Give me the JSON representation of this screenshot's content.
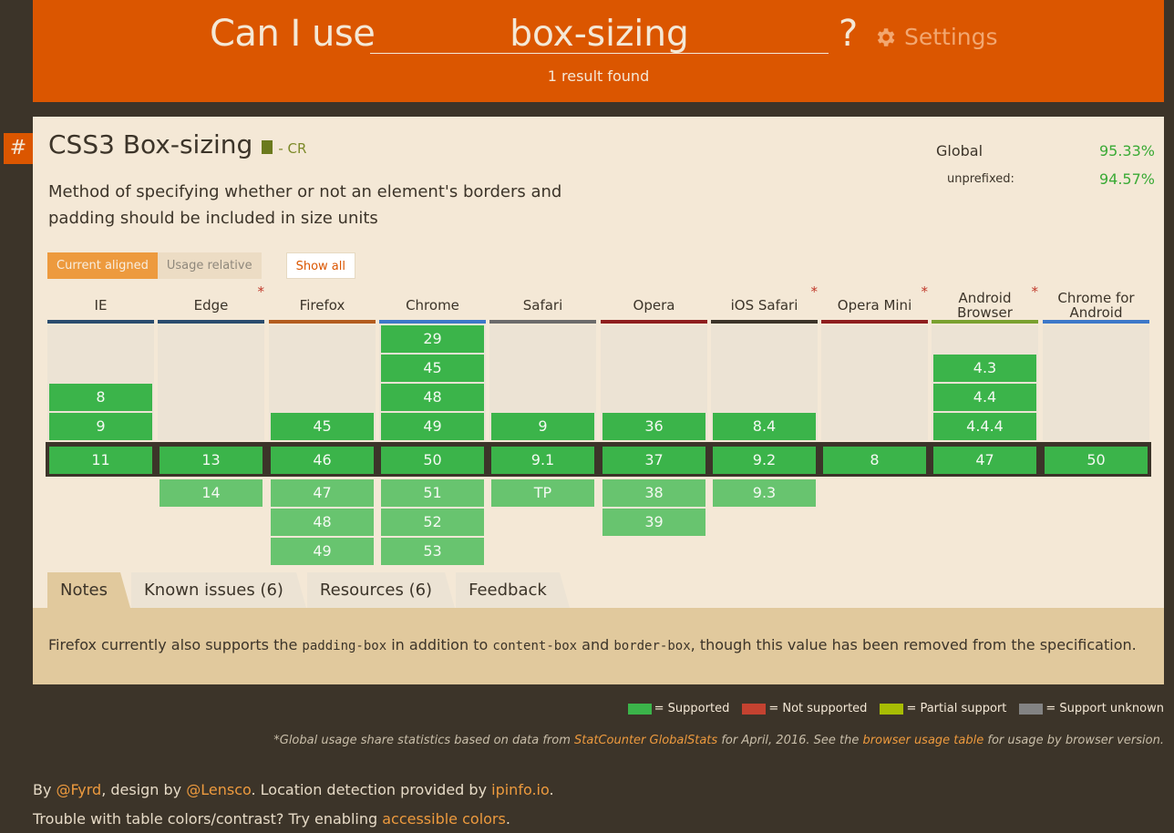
{
  "header": {
    "prefix": "Can I use",
    "search_value": "box-sizing",
    "question_mark": "?",
    "settings_label": "Settings",
    "result_count": "1 result found"
  },
  "feature": {
    "anchor": "#",
    "title": "CSS3 Box-sizing",
    "spec_status": "- CR",
    "description": "Method of specifying whether or not an element's borders and padding should be included in size units",
    "usage": {
      "global_label": "Global",
      "global_pct": "95.33%",
      "unprefixed_label": "unprefixed:",
      "unprefixed_pct": "94.57%"
    }
  },
  "toggles": {
    "current_aligned": "Current aligned",
    "usage_relative": "Usage relative",
    "show_all": "Show all"
  },
  "browsers": [
    {
      "name": "IE",
      "color": "#2a4c6e",
      "star": false,
      "past": [
        "8",
        "9"
      ],
      "current": "11",
      "future": []
    },
    {
      "name": "Edge",
      "color": "#2a4c6e",
      "star": true,
      "past": [],
      "current": "13",
      "future": [
        "14"
      ]
    },
    {
      "name": "Firefox",
      "color": "#b35c1e",
      "star": false,
      "past": [
        "45"
      ],
      "current": "46",
      "future": [
        "47",
        "48",
        "49"
      ]
    },
    {
      "name": "Chrome",
      "color": "#3d78c9",
      "star": false,
      "past": [
        "29",
        "45",
        "48",
        "49"
      ],
      "current": "50",
      "future": [
        "51",
        "52",
        "53"
      ]
    },
    {
      "name": "Safari",
      "color": "#6b6b6b",
      "star": false,
      "past": [
        "9"
      ],
      "current": "9.1",
      "future": [
        "TP"
      ]
    },
    {
      "name": "Opera",
      "color": "#8f1e1e",
      "star": false,
      "past": [
        "36"
      ],
      "current": "37",
      "future": [
        "38",
        "39"
      ]
    },
    {
      "name": "iOS Safari",
      "color": "#3c3429",
      "star": true,
      "past": [
        "8.4"
      ],
      "current": "9.2",
      "future": [
        "9.3"
      ]
    },
    {
      "name": "Opera Mini",
      "color": "#8f1e1e",
      "star": true,
      "past": [],
      "current": "8",
      "future": []
    },
    {
      "name": "Android Browser",
      "color": "#7aa12f",
      "star": true,
      "past": [
        "4.3",
        "4.4",
        "4.4.4"
      ],
      "current": "47",
      "future": []
    },
    {
      "name": "Chrome for Android",
      "color": "#3d78c9",
      "star": false,
      "past": [],
      "current": "50",
      "future": []
    }
  ],
  "tabs": [
    "Notes",
    "Known issues (6)",
    "Resources (6)",
    "Feedback"
  ],
  "notes": {
    "t1": "Firefox currently also supports the ",
    "c1": "padding-box",
    "t2": " in addition to ",
    "c2": "content-box",
    "t3": " and ",
    "c3": "border-box",
    "t4": ", though this value has been removed from the specification."
  },
  "legend": [
    {
      "label": "= Supported",
      "color": "#3bb44a"
    },
    {
      "label": "= Not supported",
      "color": "#c44230"
    },
    {
      "label": "= Partial support",
      "color": "#a8bd04"
    },
    {
      "label": "= Support unknown",
      "color": "#838383"
    }
  ],
  "stat_note": {
    "t1": "*Global usage share statistics based on data from ",
    "link1": "StatCounter GlobalStats",
    "t2": " for April, 2016. See the ",
    "link2": "browser usage table",
    "t3": " for usage by browser version."
  },
  "footer": {
    "by": "By ",
    "fyrd": "@Fyrd",
    "design": ", design by ",
    "lensco": "@Lensco",
    "loc": ". Location detection provided by ",
    "ipinfo": "ipinfo.io",
    "dot": ".",
    "trouble": "Trouble with table colors/contrast? Try enabling ",
    "accessible": "accessible colors",
    "dot2": "."
  }
}
